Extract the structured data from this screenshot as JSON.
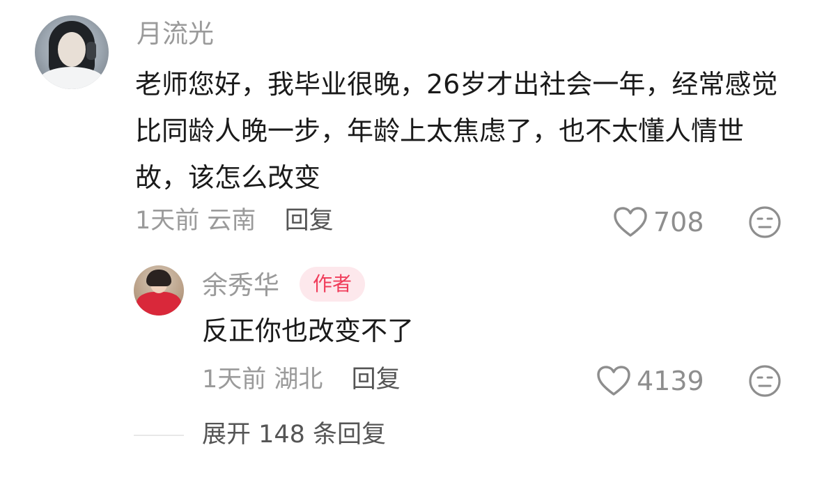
{
  "comment": {
    "username": "月流光",
    "text": "老师您好，我毕业很晚，26岁才出社会一年，经常感觉比同龄人晚一步，年龄上太焦虑了，也不太懂人情世故，该怎么改变",
    "time": "1天前",
    "location": "云南",
    "reply_label": "回复",
    "likes": "708",
    "emoji_icon": "neutral-face-icon"
  },
  "reply": {
    "username": "余秀华",
    "badge": "作者",
    "text": "反正你也改变不了",
    "time": "1天前",
    "location": "湖北",
    "reply_label": "回复",
    "likes": "4139",
    "emoji_icon": "neutral-face-icon"
  },
  "expand": {
    "label": "展开 148 条回复"
  },
  "colors": {
    "badge_text": "#f03c5a",
    "badge_bg": "#fde8ec",
    "meta_gray": "#9a9a9a",
    "body_text": "#1a1a1a"
  }
}
